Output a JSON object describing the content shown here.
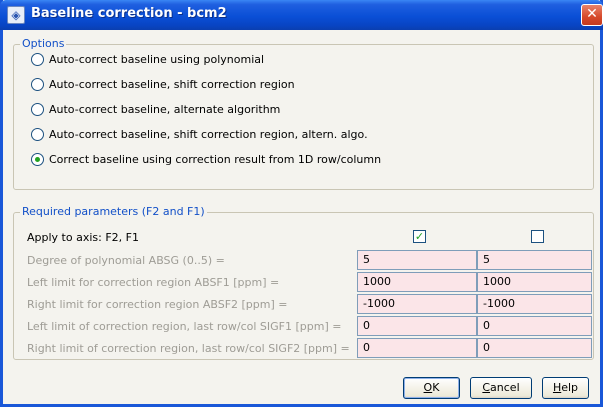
{
  "window": {
    "title": "Baseline correction - bcm2",
    "app_icon": "topspin-icon",
    "close_icon": "close-icon"
  },
  "options": {
    "group_title": "Options",
    "items": [
      {
        "label": "Auto-correct baseline using polynomial",
        "checked": false
      },
      {
        "label": "Auto-correct baseline, shift correction region",
        "checked": false
      },
      {
        "label": "Auto-correct baseline, alternate algorithm",
        "checked": false
      },
      {
        "label": "Auto-correct baseline, shift correction region, altern. algo.",
        "checked": false
      },
      {
        "label": "Correct baseline using correction result from 1D row/column",
        "checked": true
      }
    ]
  },
  "params": {
    "group_title": "Required parameters (F2 and F1)",
    "apply_axis_label": "Apply to axis: F2, F1",
    "apply_f2": true,
    "apply_f1": false,
    "rows": [
      {
        "label": "Degree of polynomial ABSG (0..5) =",
        "f2": "5",
        "f1": "5"
      },
      {
        "label": "Left limit for correction region ABSF1 [ppm] =",
        "f2": "1000",
        "f1": "1000"
      },
      {
        "label": "Right limit for correction region ABSF2 [ppm] =",
        "f2": "-1000",
        "f1": "-1000"
      },
      {
        "label": "Left limit of correction region, last row/col SIGF1 [ppm] =",
        "f2": "0",
        "f1": "0"
      },
      {
        "label": "Right limit of correction region, last row/col SIGF2 [ppm] =",
        "f2": "0",
        "f1": "0"
      }
    ]
  },
  "buttons": {
    "ok": {
      "first": "O",
      "rest": "K"
    },
    "cancel": {
      "first": "C",
      "rest": "ancel"
    },
    "help": {
      "first": "H",
      "rest": "elp"
    }
  },
  "colors": {
    "title_bar": "#0a4fd6",
    "group_title": "#1250c8",
    "field_bg": "#fbe5e8",
    "radio_dot": "#21a121"
  }
}
